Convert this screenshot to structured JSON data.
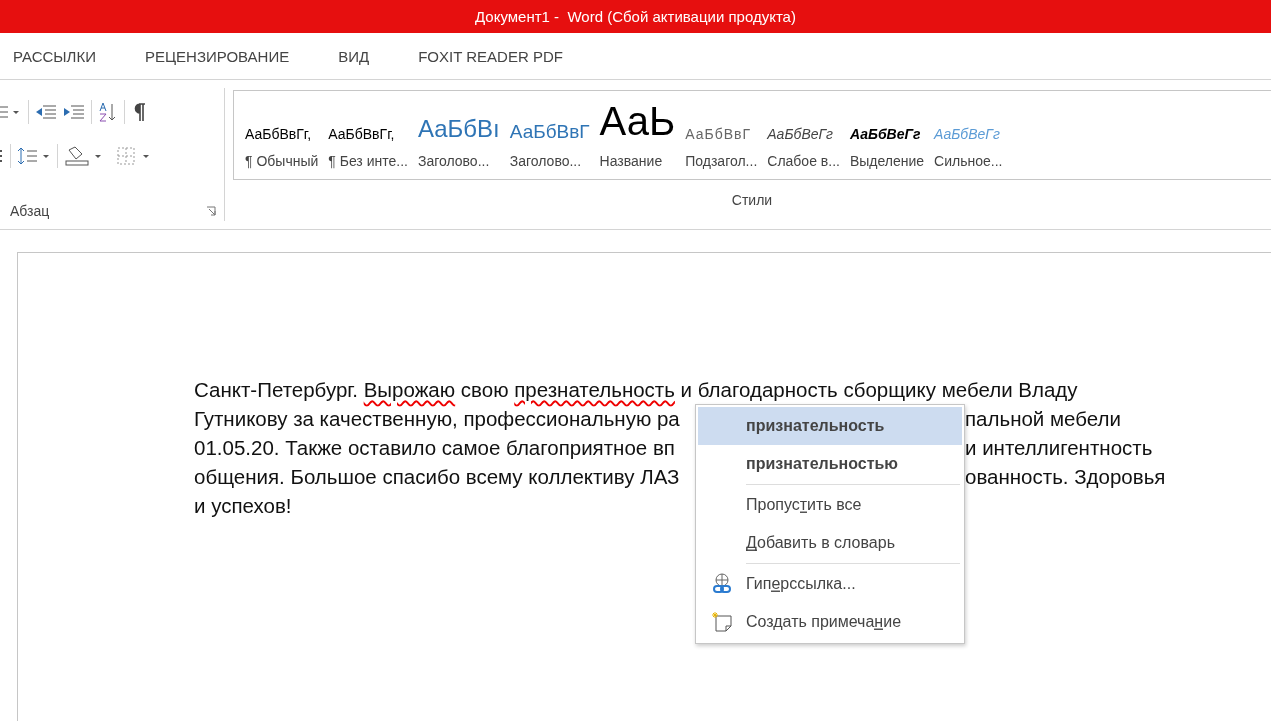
{
  "window": {
    "title": "Документ1 -  Word (Сбой активации продукта)"
  },
  "tabs": [
    {
      "label": "РАССЫЛКИ",
      "selected": false
    },
    {
      "label": "РЕЦЕНЗИРОВАНИЕ",
      "selected": false
    },
    {
      "label": "ВИД",
      "selected": false
    },
    {
      "label": "FOXIT READER PDF",
      "selected": false
    }
  ],
  "paragraph_group": {
    "label": "Абзац"
  },
  "styles_group": {
    "label": "Стили",
    "styles": [
      {
        "kind": "normal",
        "preview": "АаБбВвГг,",
        "name": "¶ Обычный"
      },
      {
        "kind": "no-spacing",
        "preview": "АаБбВвГг,",
        "name": "¶ Без инте..."
      },
      {
        "kind": "heading1",
        "preview": "АаБбВı",
        "name": "Заголово..."
      },
      {
        "kind": "heading2",
        "preview": "АаБбВвГ",
        "name": "Заголово..."
      },
      {
        "kind": "title",
        "preview": "АаЬ",
        "name": "Название"
      },
      {
        "kind": "subtitle",
        "preview": "АаБбВвГ",
        "name": "Подзагол..."
      },
      {
        "kind": "subtle-emphasis",
        "preview": "АаБбВеГг",
        "name": "Слабое в..."
      },
      {
        "kind": "emphasis",
        "preview": "АаБбВеГг",
        "name": "Выделение"
      },
      {
        "kind": "intense-emphasis",
        "preview": "АаБбВеГг",
        "name": "Сильное..."
      }
    ]
  },
  "document": {
    "lines": [
      {
        "left": [
          {
            "text": "Санкт-Петербург. ",
            "misspelled": false
          },
          {
            "text": "Вырожаю",
            "misspelled": true
          },
          {
            "text": " свою ",
            "misspelled": false
          },
          {
            "text": "презнательность",
            "misspelled": true
          },
          {
            "text": " и благодарность сборщику мебели Владу",
            "misspelled": false
          }
        ]
      },
      {
        "left": [
          {
            "text": "Гутникову за качественную, профессиональную ра",
            "misspelled": false
          }
        ],
        "right": "пальной мебели"
      },
      {
        "left": [
          {
            "text": "01.05.20. Также оставило самое благоприятное вп",
            "misspelled": false
          }
        ],
        "right": "и интеллигентность"
      },
      {
        "left": [
          {
            "text": "общения. Большое спасибо всему коллективу ЛАЗ",
            "misspelled": false
          }
        ],
        "right": "ованность. Здоровья"
      },
      {
        "left": [
          {
            "text": "и успехов!",
            "misspelled": false
          }
        ]
      }
    ]
  },
  "context_menu": {
    "groups": [
      [
        {
          "kind": "suggestion",
          "label_parts": [
            {
              "text": "признательность",
              "underlined": false
            }
          ],
          "selected": true
        },
        {
          "kind": "suggestion",
          "label_parts": [
            {
              "text": "признательностью",
              "underlined": false
            }
          ],
          "selected": false
        }
      ],
      [
        {
          "kind": "command",
          "label_parts": [
            {
              "text": "Пропус",
              "underlined": false
            },
            {
              "text": "т",
              "underlined": true
            },
            {
              "text": "ить все",
              "underlined": false
            }
          ],
          "selected": false
        },
        {
          "kind": "command",
          "label_parts": [
            {
              "text": "Д",
              "underlined": true
            },
            {
              "text": "обавить в словарь",
              "underlined": false
            }
          ],
          "selected": false
        }
      ],
      [
        {
          "kind": "hyperlink",
          "label_parts": [
            {
              "text": "Гип",
              "underlined": false
            },
            {
              "text": "е",
              "underlined": true
            },
            {
              "text": "рссылка...",
              "underlined": false
            }
          ],
          "selected": false
        },
        {
          "kind": "comment",
          "label_parts": [
            {
              "text": "Создать примеча",
              "underlined": false
            },
            {
              "text": "н",
              "underlined": true
            },
            {
              "text": "ие",
              "underlined": false
            }
          ],
          "selected": false
        }
      ]
    ]
  }
}
